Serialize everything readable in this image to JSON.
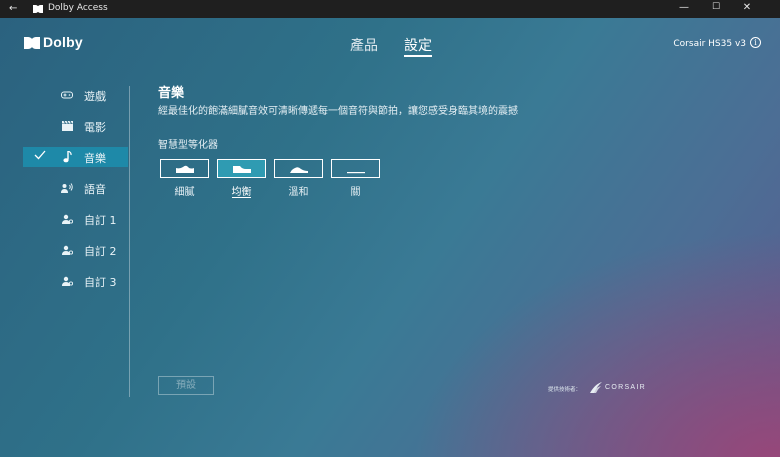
{
  "window": {
    "title": "Dolby Access",
    "back_glyph": "←",
    "controls": {
      "minimize": "—",
      "maximize": "☐",
      "close": "✕"
    }
  },
  "brand": {
    "name": "Dolby"
  },
  "topnav": {
    "products": "產品",
    "settings": "設定",
    "active": "settings"
  },
  "device": {
    "name": "Corsair HS35 v3",
    "info_icon": "i"
  },
  "sidebar": {
    "items": [
      {
        "label": "遊戲",
        "icon": "gamepad-icon"
      },
      {
        "label": "電影",
        "icon": "clapperboard-icon"
      },
      {
        "label": "音樂",
        "icon": "music-note-icon",
        "active": true
      },
      {
        "label": "語音",
        "icon": "voice-icon"
      },
      {
        "label": "自訂 1",
        "icon": "user-custom-icon"
      },
      {
        "label": "自訂 2",
        "icon": "user-custom-icon"
      },
      {
        "label": "自訂 3",
        "icon": "user-custom-icon"
      }
    ]
  },
  "main": {
    "title": "音樂",
    "description": "經最佳化的飽滿細膩音效可清晰傳遞每一個音符與節拍，讓您感受身臨其境的震撼",
    "eq_label": "智慧型等化器",
    "eq_presets": [
      {
        "label": "細膩",
        "icon": "eq-detailed-icon"
      },
      {
        "label": "均衡",
        "icon": "eq-balanced-icon",
        "selected": true
      },
      {
        "label": "溫和",
        "icon": "eq-warm-icon"
      },
      {
        "label": "關",
        "icon": "eq-off-icon"
      }
    ],
    "reset_label": "預設"
  },
  "footer": {
    "provided_by": "提供技術者：",
    "partner": "CORSAIR"
  },
  "colors": {
    "accent": "#1e89a8",
    "selected_eq": "#2f9bb2",
    "titlebar": "#1f1f1f"
  }
}
